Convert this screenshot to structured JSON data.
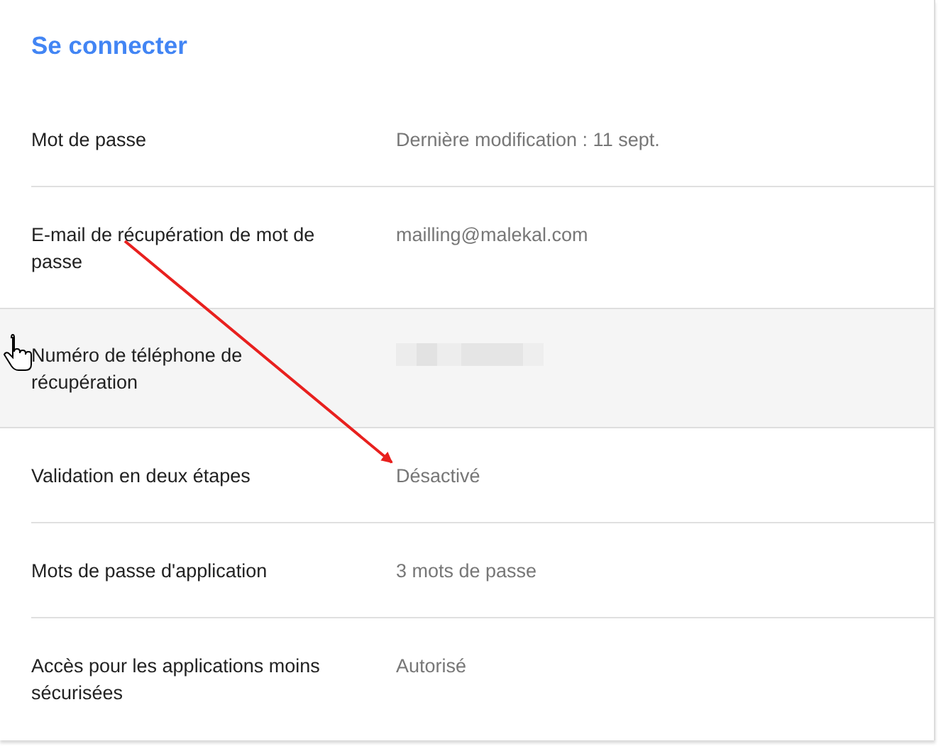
{
  "section": {
    "title": "Se connecter"
  },
  "rows": [
    {
      "label": "Mot de passe",
      "value": "Dernière modification : 11 sept.",
      "redacted": false,
      "highlighted": false
    },
    {
      "label": "E-mail de récupération de mot de passe",
      "value": "mailling@malekal.com",
      "redacted": false,
      "highlighted": false
    },
    {
      "label": "Numéro de téléphone de récupération",
      "redacted": true,
      "highlighted": true
    },
    {
      "label": "Validation en deux étapes",
      "value": "Désactivé",
      "redacted": false,
      "highlighted": false
    },
    {
      "label": "Mots de passe d'application",
      "value": "3 mots de passe",
      "redacted": false,
      "highlighted": false
    },
    {
      "label": "Accès pour les applications moins sécurisées",
      "value": "Autorisé",
      "redacted": false,
      "highlighted": false
    }
  ]
}
